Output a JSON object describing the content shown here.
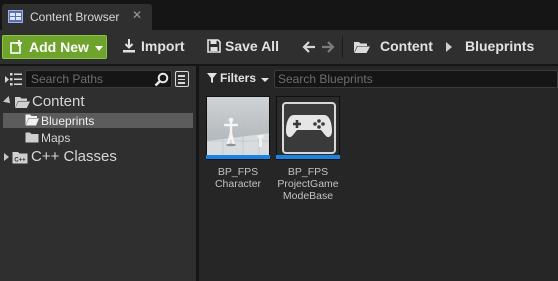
{
  "tab": {
    "title": "Content Browser",
    "close_glyph": "✕",
    "icon": "content-browser-icon"
  },
  "toolbar": {
    "add_new_label": "Add New",
    "import_label": "Import",
    "save_all_label": "Save All",
    "add_new_color": "#6ea42b",
    "icons": [
      "add-new-icon",
      "import-icon",
      "save-all-icon",
      "back-arrow-icon",
      "forward-arrow-icon"
    ]
  },
  "breadcrumb": {
    "items": [
      "Content",
      "Blueprints"
    ]
  },
  "sources": {
    "search_placeholder": "Search Paths",
    "tree": [
      {
        "label": "Content",
        "expanded": true,
        "depth": 0
      },
      {
        "label": "Blueprints",
        "selected": true,
        "depth": 1
      },
      {
        "label": "Maps",
        "depth": 1
      },
      {
        "label": "C++ Classes",
        "expanded": false,
        "depth": 0
      }
    ]
  },
  "assets_panel": {
    "filters_label": "Filters",
    "search_placeholder": "Search Blueprints",
    "selection_color": "#1c83e0",
    "items": [
      {
        "name_lines": [
          "BP_FPS",
          "Character"
        ],
        "thumbnail": "mannequin-thumbnail"
      },
      {
        "name_lines": [
          "BP_FPS",
          "ProjectGame",
          "ModeBase"
        ],
        "thumbnail": "gamepad-thumbnail"
      }
    ]
  }
}
